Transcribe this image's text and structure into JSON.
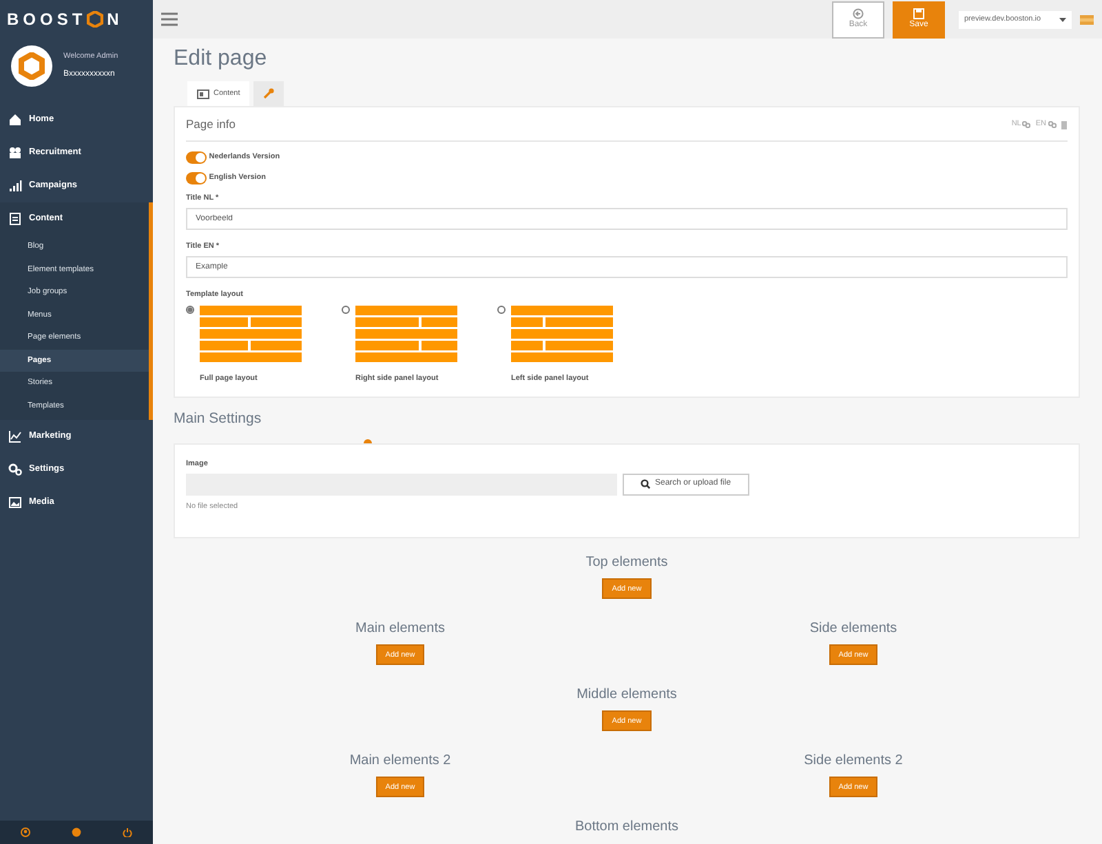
{
  "brand": {
    "text_start": "BOOST",
    "text_end": "N"
  },
  "user": {
    "welcome": "Welcome Admin",
    "name": "Bxxxxxxxxxxn"
  },
  "nav": [
    {
      "label": "Home",
      "kind": "home",
      "expanded": false
    },
    {
      "label": "Recruitment",
      "kind": "people",
      "expanded": false
    },
    {
      "label": "Campaigns",
      "kind": "bars",
      "expanded": false
    },
    {
      "label": "Content",
      "kind": "doc",
      "expanded": true,
      "children": [
        {
          "label": "Blog",
          "selected": false
        },
        {
          "label": "Element templates",
          "selected": false
        },
        {
          "label": "Job groups",
          "selected": false
        },
        {
          "label": "Menus",
          "selected": false
        },
        {
          "label": "Page elements",
          "selected": false
        },
        {
          "label": "Pages",
          "selected": true
        },
        {
          "label": "Stories",
          "selected": false
        },
        {
          "label": "Templates",
          "selected": false
        }
      ]
    },
    {
      "label": "Marketing",
      "kind": "chart",
      "expanded": false
    },
    {
      "label": "Settings",
      "kind": "gears",
      "expanded": false
    },
    {
      "label": "Media",
      "kind": "image",
      "expanded": false
    }
  ],
  "topbar": {
    "back": "Back",
    "save": "Save",
    "site": "preview.dev.booston.io"
  },
  "heading": "Edit page",
  "tabs": [
    {
      "kind": "text",
      "label": "Content",
      "selected": true
    },
    {
      "kind": "wrench",
      "selected": false
    }
  ],
  "page_info": {
    "title": "Page info",
    "languages": [
      "NL",
      "EN"
    ],
    "toggles": [
      {
        "label": "Nederlands Version",
        "on": true
      },
      {
        "label": "English Version",
        "on": true
      }
    ],
    "fields": [
      {
        "label": "Title NL *",
        "value": "Voorbeeld"
      },
      {
        "label": "Title EN *",
        "value": "Example"
      }
    ],
    "layout_label": "Template layout",
    "layouts": [
      {
        "kind": "full",
        "label": "Full page layout",
        "selected": true
      },
      {
        "kind": "right",
        "label": "Right side panel layout",
        "selected": false
      },
      {
        "kind": "left",
        "label": "Left side panel layout",
        "selected": false
      }
    ]
  },
  "main_settings": {
    "title": "Main Settings",
    "image_label": "Image",
    "button": "Search or upload file",
    "note": "No file selected"
  },
  "element_rows": [
    [
      {
        "title": "Top elements",
        "button": "Add new"
      }
    ],
    [
      {
        "title": "Main elements",
        "button": "Add new"
      },
      {
        "title": "Side elements",
        "button": "Add new"
      }
    ],
    [
      {
        "title": "Middle elements",
        "button": "Add new"
      }
    ],
    [
      {
        "title": "Main elements 2",
        "button": "Add new"
      },
      {
        "title": "Side elements 2",
        "button": "Add new"
      }
    ],
    [
      {
        "title": "Bottom elements"
      }
    ]
  ]
}
